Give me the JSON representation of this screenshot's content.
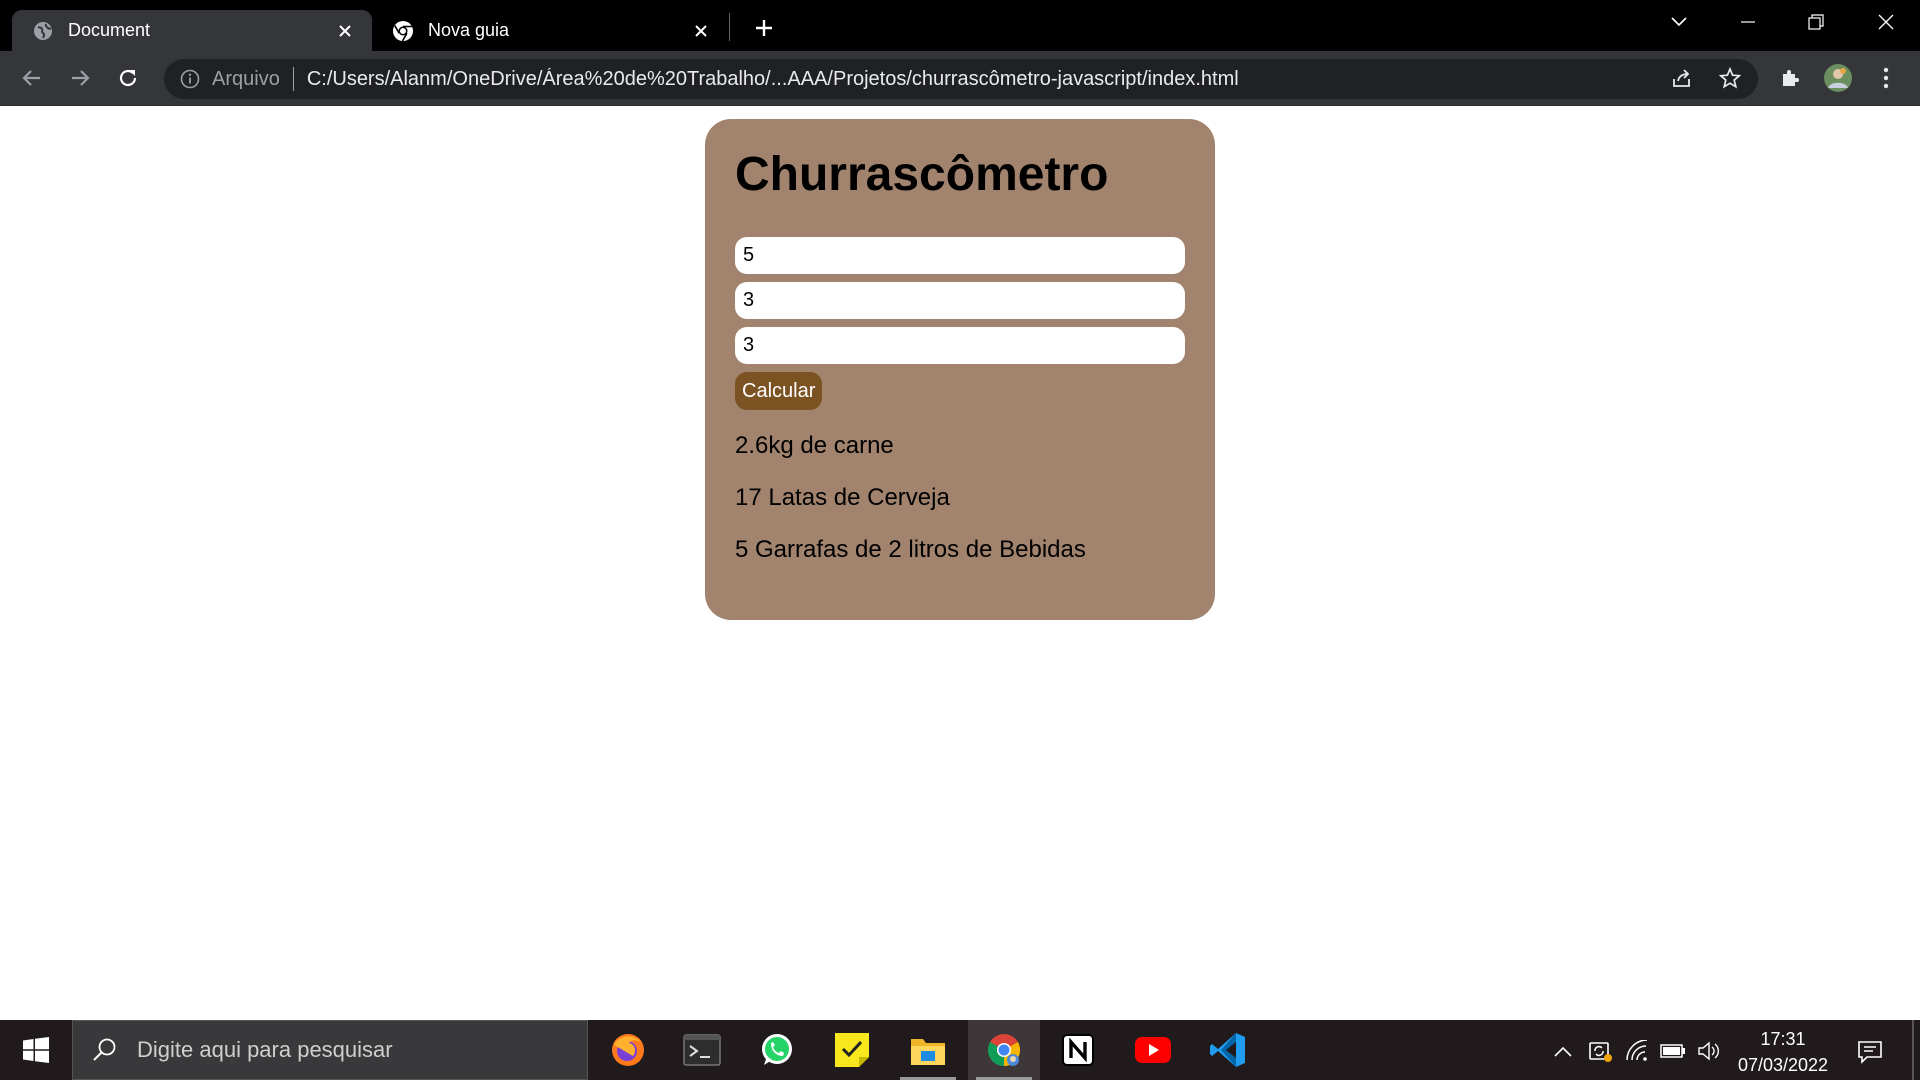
{
  "browser": {
    "tabs": [
      {
        "title": "Document",
        "active": true
      },
      {
        "title": "Nova guia",
        "active": false
      }
    ],
    "address_bar": {
      "scheme_label": "Arquivo",
      "url": "C:/Users/Alanm/OneDrive/Área%20de%20Trabalho/...AAA/Projetos/churrascômetro-javascript/index.html"
    }
  },
  "page": {
    "title": "Churrascômetro",
    "inputs": [
      "5",
      "3",
      "3"
    ],
    "button_label": "Calcular",
    "results": [
      "2.6kg de carne",
      "17 Latas de Cerveja",
      "5 Garrafas de 2 litros de Bebidas"
    ],
    "colors": {
      "card": "#a1836e",
      "button": "#7b5323"
    }
  },
  "taskbar": {
    "search_placeholder": "Digite aqui para pesquisar",
    "apps": [
      "firefox-icon",
      "terminal-icon",
      "whatsapp-icon",
      "sticky-notes-icon",
      "file-explorer-icon",
      "chrome-icon",
      "notion-icon",
      "youtube-icon",
      "vscode-icon"
    ],
    "time": "17:31",
    "date": "07/03/2022"
  }
}
